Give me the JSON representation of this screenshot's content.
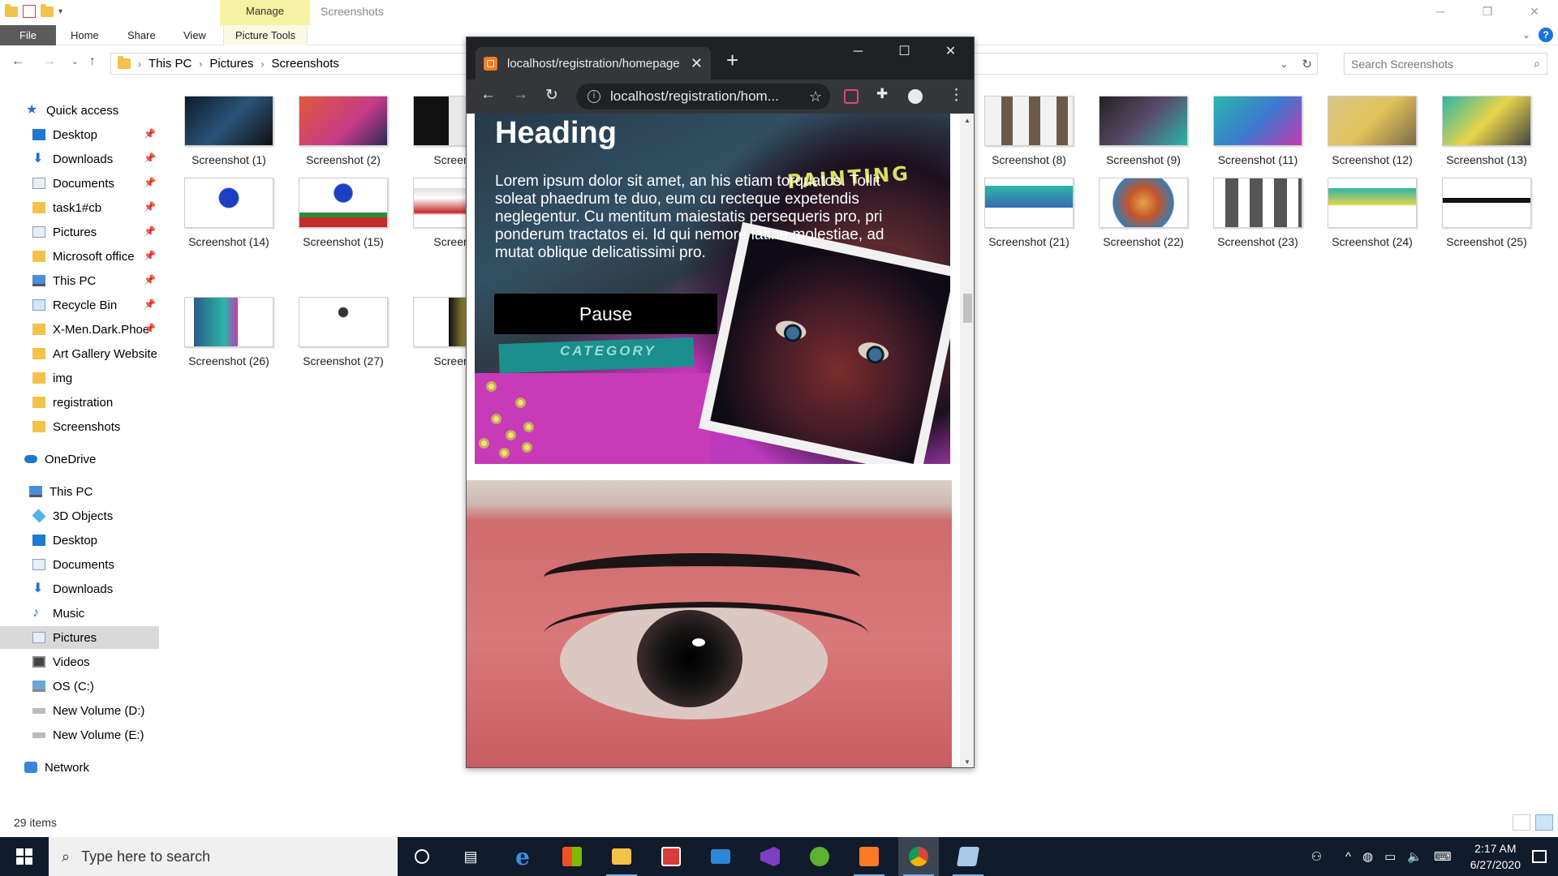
{
  "explorer": {
    "manage_tab": "Manage",
    "window_title": "Screenshots",
    "ribbon": {
      "file": "File",
      "home": "Home",
      "share": "Share",
      "view": "View",
      "picture_tools": "Picture Tools"
    },
    "breadcrumb": [
      "This PC",
      "Pictures",
      "Screenshots"
    ],
    "search_placeholder": "Search Screenshots",
    "nav": {
      "quick_access": "Quick access",
      "quick_items": [
        "Desktop",
        "Downloads",
        "Documents",
        "task1#cb",
        "Pictures",
        "Microsoft office",
        "This PC",
        "Recycle Bin",
        "X-Men.Dark.Phoe",
        "Art Gallery Website",
        "img",
        "registration",
        "Screenshots"
      ],
      "onedrive": "OneDrive",
      "this_pc": "This PC",
      "pc_items": [
        "3D Objects",
        "Desktop",
        "Documents",
        "Downloads",
        "Music",
        "Pictures",
        "Videos",
        "OS (C:)",
        "New Volume (D:)",
        "New Volume (E:)"
      ],
      "network": "Network"
    },
    "files": [
      "Screenshot (1)",
      "Screenshot (2)",
      "Screensh",
      "Screenshot (8)",
      "Screenshot (9)",
      "Screenshot (11)",
      "Screenshot (12)",
      "Screenshot (13)",
      "Screenshot (14)",
      "Screenshot (15)",
      "Screensh",
      "Screenshot (21)",
      "Screenshot (22)",
      "Screenshot (23)",
      "Screenshot (24)",
      "Screenshot (25)",
      "Screenshot (26)",
      "Screenshot (27)",
      "Screensh"
    ],
    "status": "29 items"
  },
  "chrome": {
    "tab_title": "localhost/registration/homepage",
    "url": "localhost/registration/hom...",
    "page": {
      "heading": "Heading",
      "paragraph": "Lorem ipsum dolor sit amet, an his etiam torquatos. Tollit soleat phaedrum te duo, eum cu recteque expetendis neglegentur. Cu mentitum maiestatis persequeris pro, pri ponderum tractatos ei. Id qui nemore latine molestiae, ad mutat oblique delicatissimi pro.",
      "pause_label": "Pause",
      "sticker_text": "PAINTING",
      "category_text": "CATEGORY"
    }
  },
  "taskbar": {
    "search_placeholder": "Type here to search",
    "time": "2:17 AM",
    "date": "6/27/2020"
  }
}
